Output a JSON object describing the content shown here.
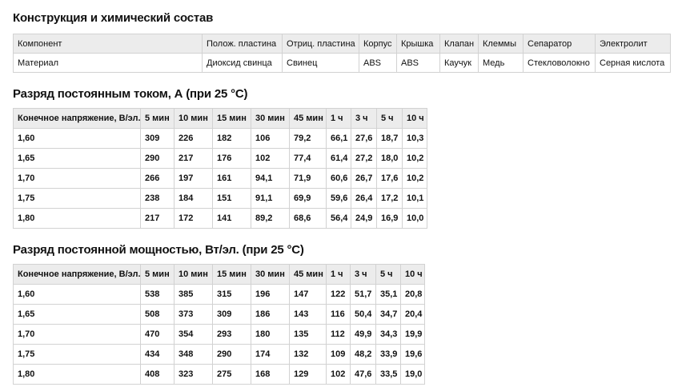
{
  "construction": {
    "title": "Конструкция и химический состав",
    "headers": [
      "Компонент",
      "Полож. пластина",
      "Отриц. пластина",
      "Корпус",
      "Крышка",
      "Клапан",
      "Клеммы",
      "Сепаратор",
      "Электролит"
    ],
    "row": [
      "Материал",
      "Диоксид свинца",
      "Свинец",
      "ABS",
      "ABS",
      "Каучук",
      "Медь",
      "Стекловолокно",
      "Серная кислота"
    ]
  },
  "current_discharge": {
    "title": "Разряд постоянным током, А (при 25 °C)",
    "headers": [
      "Конечное напряжение, В/эл.",
      "5 мин",
      "10 мин",
      "15 мин",
      "30 мин",
      "45 мин",
      "1 ч",
      "3 ч",
      "5 ч",
      "10 ч"
    ],
    "rows": [
      [
        "1,60",
        "309",
        "226",
        "182",
        "106",
        "79,2",
        "66,1",
        "27,6",
        "18,7",
        "10,3"
      ],
      [
        "1,65",
        "290",
        "217",
        "176",
        "102",
        "77,4",
        "61,4",
        "27,2",
        "18,0",
        "10,2"
      ],
      [
        "1,70",
        "266",
        "197",
        "161",
        "94,1",
        "71,9",
        "60,6",
        "26,7",
        "17,6",
        "10,2"
      ],
      [
        "1,75",
        "238",
        "184",
        "151",
        "91,1",
        "69,9",
        "59,6",
        "26,4",
        "17,2",
        "10,1"
      ],
      [
        "1,80",
        "217",
        "172",
        "141",
        "89,2",
        "68,6",
        "56,4",
        "24,9",
        "16,9",
        "10,0"
      ]
    ]
  },
  "power_discharge": {
    "title": "Разряд постоянной мощностью, Вт/эл. (при 25 °C)",
    "headers": [
      "Конечное напряжение, В/эл.",
      "5 мин",
      "10 мин",
      "15 мин",
      "30 мин",
      "45 мин",
      "1 ч",
      "3 ч",
      "5 ч",
      "10 ч"
    ],
    "rows": [
      [
        "1,60",
        "538",
        "385",
        "315",
        "196",
        "147",
        "122",
        "51,7",
        "35,1",
        "20,8"
      ],
      [
        "1,65",
        "508",
        "373",
        "309",
        "186",
        "143",
        "116",
        "50,4",
        "34,7",
        "20,4"
      ],
      [
        "1,70",
        "470",
        "354",
        "293",
        "180",
        "135",
        "112",
        "49,9",
        "34,3",
        "19,9"
      ],
      [
        "1,75",
        "434",
        "348",
        "290",
        "174",
        "132",
        "109",
        "48,2",
        "33,9",
        "19,6"
      ],
      [
        "1,80",
        "408",
        "323",
        "275",
        "168",
        "129",
        "102",
        "47,6",
        "33,5",
        "19,0"
      ]
    ]
  }
}
